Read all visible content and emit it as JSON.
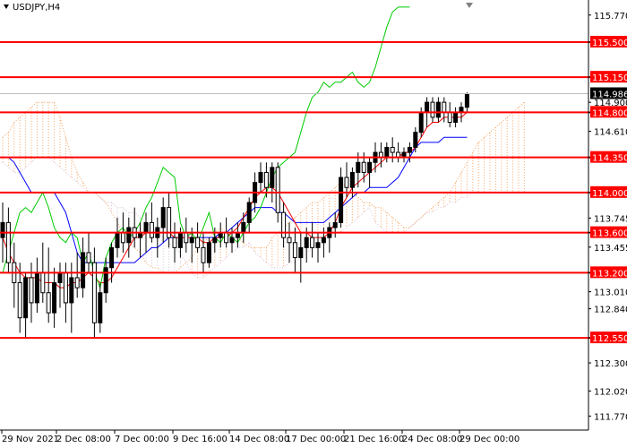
{
  "symbol_title": "USDJPY,H4",
  "colors": {
    "level_line": "#ff0000",
    "level_label_bg": "#ff0000",
    "level_label_text": "#ffffff",
    "current_label_bg": "#000000",
    "current_label_text": "#ffffff",
    "bull_candle": "#000000",
    "bear_candle": "#ffffff",
    "tenkan": "#ff0000",
    "kijun": "#0000ff",
    "chikou": "#00cc00",
    "cloud_bull": "#f4a460",
    "cloud_bear": "#d8bfd8",
    "grid": "#c0c0c0"
  },
  "chart_data": {
    "type": "candlestick",
    "title": "USDJPY,H4",
    "ylim": [
      111.63,
      115.92
    ],
    "y_ticks": [
      115.77,
      115.5,
      115.15,
      114.9,
      114.8,
      114.61,
      114.35,
      114.0,
      113.745,
      113.6,
      113.455,
      113.2,
      113.01,
      112.84,
      112.55,
      112.3,
      112.02,
      111.77
    ],
    "y_tick_labels": [
      "115.770",
      "115.500",
      "115.150",
      "114.900",
      "114.800",
      "114.610",
      "114.350",
      "114.000",
      "113.745",
      "113.600",
      "113.455",
      "113.200",
      "113.010",
      "112.840",
      "112.550",
      "112.300",
      "112.020",
      "111.770"
    ],
    "x_labels": [
      "29 Nov 2021",
      "2 Dec 08:00",
      "7 Dec 00:00",
      "9 Dec 16:00",
      "14 Dec 08:00",
      "17 Dec 00:00",
      "21 Dec 16:00",
      "24 Dec 08:00",
      "29 Dec 00:00"
    ],
    "levels": [
      115.5,
      115.15,
      114.8,
      114.35,
      114.0,
      113.6,
      113.2,
      112.55
    ],
    "level_labels": [
      "115.500",
      "115.150",
      "114.800",
      "114.350",
      "114.000",
      "113.600",
      "113.200",
      "112.550"
    ],
    "current_price": 114.986,
    "current_price_label": "114.986",
    "candles": [
      [
        113.55,
        113.9,
        113.3,
        113.7
      ],
      [
        113.7,
        113.85,
        113.2,
        113.3
      ],
      [
        113.3,
        113.5,
        112.85,
        113.1
      ],
      [
        113.1,
        113.3,
        112.6,
        112.75
      ],
      [
        112.75,
        113.2,
        112.55,
        113.15
      ],
      [
        113.15,
        113.3,
        112.7,
        112.9
      ],
      [
        112.9,
        113.35,
        112.8,
        113.2
      ],
      [
        113.2,
        113.5,
        112.9,
        113.0
      ],
      [
        113.0,
        113.45,
        112.7,
        112.8
      ],
      [
        112.8,
        113.25,
        112.65,
        113.1
      ],
      [
        113.1,
        113.3,
        112.85,
        113.2
      ],
      [
        113.2,
        113.3,
        112.7,
        112.9
      ],
      [
        112.9,
        113.3,
        112.6,
        113.15
      ],
      [
        113.15,
        113.4,
        112.95,
        113.05
      ],
      [
        113.05,
        113.55,
        112.95,
        113.4
      ],
      [
        113.4,
        113.6,
        113.2,
        113.3
      ],
      [
        113.3,
        113.45,
        112.55,
        112.7
      ],
      [
        112.7,
        113.1,
        112.6,
        113.0
      ],
      [
        113.0,
        113.35,
        112.9,
        113.25
      ],
      [
        113.25,
        113.5,
        113.1,
        113.45
      ],
      [
        113.45,
        113.75,
        113.35,
        113.6
      ],
      [
        113.6,
        113.8,
        113.4,
        113.5
      ],
      [
        113.5,
        113.75,
        113.35,
        113.65
      ],
      [
        113.65,
        113.85,
        113.45,
        113.55
      ],
      [
        113.55,
        113.7,
        113.35,
        113.6
      ],
      [
        113.6,
        113.8,
        113.4,
        113.7
      ],
      [
        113.7,
        113.9,
        113.5,
        113.55
      ],
      [
        113.55,
        113.75,
        113.35,
        113.65
      ],
      [
        113.65,
        113.95,
        113.5,
        113.85
      ],
      [
        113.85,
        114.0,
        113.45,
        113.55
      ],
      [
        113.55,
        113.7,
        113.3,
        113.45
      ],
      [
        113.45,
        113.65,
        113.35,
        113.6
      ],
      [
        113.6,
        113.75,
        113.4,
        113.5
      ],
      [
        113.5,
        113.65,
        113.3,
        113.55
      ],
      [
        113.55,
        113.7,
        113.4,
        113.45
      ],
      [
        113.45,
        113.6,
        113.2,
        113.3
      ],
      [
        113.3,
        113.55,
        113.25,
        113.5
      ],
      [
        113.5,
        113.65,
        113.4,
        113.55
      ],
      [
        113.55,
        113.7,
        113.45,
        113.6
      ],
      [
        113.6,
        113.75,
        113.45,
        113.5
      ],
      [
        113.5,
        113.65,
        113.4,
        113.55
      ],
      [
        113.55,
        113.7,
        113.45,
        113.6
      ],
      [
        113.6,
        113.8,
        113.5,
        113.7
      ],
      [
        113.7,
        113.95,
        113.6,
        113.9
      ],
      [
        113.9,
        114.2,
        113.8,
        114.1
      ],
      [
        114.1,
        114.3,
        114.0,
        114.2
      ],
      [
        114.2,
        114.3,
        113.95,
        114.05
      ],
      [
        114.05,
        114.3,
        113.9,
        114.25
      ],
      [
        114.25,
        114.3,
        113.7,
        113.8
      ],
      [
        113.8,
        113.9,
        113.45,
        113.55
      ],
      [
        113.55,
        113.7,
        113.3,
        113.5
      ],
      [
        113.5,
        113.65,
        113.2,
        113.35
      ],
      [
        113.35,
        113.6,
        113.1,
        113.45
      ],
      [
        113.45,
        113.65,
        113.3,
        113.55
      ],
      [
        113.55,
        113.7,
        113.35,
        113.45
      ],
      [
        113.45,
        113.6,
        113.3,
        113.5
      ],
      [
        113.5,
        113.65,
        113.35,
        113.55
      ],
      [
        113.55,
        113.7,
        113.4,
        113.65
      ],
      [
        113.65,
        113.8,
        113.55,
        113.7
      ],
      [
        113.7,
        114.25,
        113.65,
        114.15
      ],
      [
        114.15,
        114.3,
        113.95,
        114.05
      ],
      [
        114.05,
        114.25,
        113.95,
        114.2
      ],
      [
        114.2,
        114.4,
        114.05,
        114.3
      ],
      [
        114.3,
        114.4,
        114.1,
        114.2
      ],
      [
        114.2,
        114.35,
        114.05,
        114.3
      ],
      [
        114.3,
        114.5,
        114.2,
        114.4
      ],
      [
        114.4,
        114.5,
        114.25,
        114.35
      ],
      [
        114.35,
        114.5,
        114.3,
        114.45
      ],
      [
        114.45,
        114.55,
        114.3,
        114.4
      ],
      [
        114.4,
        114.5,
        114.3,
        114.35
      ],
      [
        114.35,
        114.45,
        114.3,
        114.4
      ],
      [
        114.4,
        114.5,
        114.3,
        114.45
      ],
      [
        114.45,
        114.65,
        114.4,
        114.6
      ],
      [
        114.6,
        114.85,
        114.55,
        114.8
      ],
      [
        114.8,
        114.95,
        114.65,
        114.9
      ],
      [
        114.9,
        114.95,
        114.7,
        114.75
      ],
      [
        114.75,
        114.95,
        114.7,
        114.9
      ],
      [
        114.9,
        114.95,
        114.7,
        114.8
      ],
      [
        114.8,
        114.9,
        114.65,
        114.7
      ],
      [
        114.7,
        114.85,
        114.65,
        114.8
      ],
      [
        114.8,
        114.9,
        114.7,
        114.85
      ],
      [
        114.85,
        115.0,
        114.8,
        114.986
      ]
    ],
    "series": [
      {
        "name": "",
        "type": "tenkan"
      },
      {
        "name": "",
        "type": "kijun"
      },
      {
        "name": "",
        "type": "chikou"
      }
    ],
    "tenkan": [
      113.55,
      113.4,
      113.3,
      113.2,
      113.15,
      113.15,
      113.15,
      113.1,
      113.1,
      113.1,
      113.05,
      113.05,
      113.1,
      113.1,
      113.15,
      113.2,
      113.15,
      113.1,
      113.1,
      113.15,
      113.25,
      113.35,
      113.45,
      113.55,
      113.55,
      113.6,
      113.6,
      113.6,
      113.6,
      113.6,
      113.55,
      113.55,
      113.55,
      113.55,
      113.55,
      113.5,
      113.5,
      113.55,
      113.55,
      113.55,
      113.6,
      113.65,
      113.75,
      113.85,
      113.95,
      114.0,
      114.05,
      114.05,
      114.0,
      113.9,
      113.8,
      113.7,
      113.6,
      113.6,
      113.55,
      113.55,
      113.55,
      113.6,
      113.7,
      113.85,
      113.95,
      114.05,
      114.1,
      114.15,
      114.2,
      114.25,
      114.3,
      114.35,
      114.35,
      114.35,
      114.4,
      114.4,
      114.45,
      114.55,
      114.65,
      114.7,
      114.7,
      114.75,
      114.75,
      114.75,
      114.75,
      114.8
    ],
    "kijun": [
      114.35,
      114.35,
      114.3,
      114.2,
      114.1,
      114.0,
      114.0,
      114.0,
      114.0,
      114.0,
      113.9,
      113.8,
      113.6,
      113.4,
      113.3,
      113.3,
      113.3,
      113.3,
      113.3,
      113.3,
      113.3,
      113.3,
      113.3,
      113.3,
      113.35,
      113.4,
      113.45,
      113.45,
      113.5,
      113.55,
      113.55,
      113.55,
      113.55,
      113.55,
      113.55,
      113.55,
      113.55,
      113.55,
      113.6,
      113.6,
      113.65,
      113.7,
      113.75,
      113.8,
      113.85,
      113.85,
      113.85,
      113.85,
      113.8,
      113.8,
      113.75,
      113.7,
      113.7,
      113.7,
      113.7,
      113.7,
      113.7,
      113.75,
      113.8,
      113.85,
      113.9,
      113.95,
      114.0,
      114.0,
      114.05,
      114.05,
      114.05,
      114.05,
      114.1,
      114.15,
      114.25,
      114.35,
      114.45,
      114.5,
      114.5,
      114.5,
      114.5,
      114.55,
      114.55,
      114.55,
      114.55,
      114.55
    ],
    "chikou": [
      113.2,
      113.4,
      113.6,
      113.8,
      113.85,
      113.8,
      113.9,
      114.0,
      113.85,
      113.65,
      113.55,
      113.5,
      113.6,
      113.55,
      113.3,
      113.4,
      113.2,
      113.05,
      113.35,
      113.5,
      113.6,
      113.65,
      113.55,
      113.6,
      113.7,
      113.85,
      113.95,
      114.1,
      114.25,
      114.2,
      114.15,
      113.7,
      113.55,
      113.6,
      113.5,
      113.65,
      113.8,
      113.55,
      113.5,
      113.6,
      113.55,
      113.5,
      113.6,
      113.7,
      113.75,
      113.85,
      114.0,
      114.15,
      114.25,
      114.3,
      114.35,
      114.4,
      114.6,
      114.8,
      114.95,
      115.0,
      115.1,
      115.05,
      115.1,
      115.1,
      115.15,
      115.2,
      115.1,
      115.05,
      115.1,
      115.25,
      115.45,
      115.65,
      115.8,
      115.85,
      115.85,
      115.85
    ],
    "cloud": {
      "senkou_a": [
        114.55,
        114.6,
        114.7,
        114.75,
        114.8,
        114.85,
        114.9,
        114.9,
        114.9,
        114.9,
        114.75,
        114.55,
        114.35,
        114.2,
        114.1,
        114.0,
        114.0,
        113.95,
        113.9,
        113.8,
        113.7,
        113.6,
        113.5,
        113.45,
        113.4,
        113.3,
        113.25,
        113.25,
        113.2,
        113.2,
        113.2,
        113.25,
        113.3,
        113.35,
        113.45,
        113.5,
        113.55,
        113.6,
        113.65,
        113.6,
        113.55,
        113.55,
        113.5,
        113.45,
        113.45,
        113.45,
        113.45,
        113.55,
        113.6,
        113.65,
        113.7,
        113.75,
        113.8,
        113.85,
        113.9,
        113.9,
        113.95,
        114.0,
        114.05,
        114.1,
        114.05,
        114.0,
        113.95,
        113.9,
        113.9,
        113.85,
        113.85,
        113.8,
        113.75,
        113.7,
        113.65,
        113.65,
        113.7,
        113.75,
        113.8,
        113.85,
        113.9,
        113.95,
        114.0,
        114.1,
        114.2,
        114.3,
        114.4,
        114.5,
        114.55,
        114.6,
        114.65,
        114.7,
        114.75,
        114.8,
        114.85,
        114.9
      ],
      "senkou_b": [
        114.3,
        114.25,
        114.2,
        114.2,
        114.25,
        114.3,
        114.35,
        114.35,
        114.35,
        114.3,
        114.25,
        114.2,
        114.15,
        114.1,
        114.05,
        114.0,
        114.0,
        113.95,
        113.9,
        113.9,
        113.85,
        113.85,
        113.8,
        113.8,
        113.75,
        113.7,
        113.65,
        113.6,
        113.55,
        113.5,
        113.45,
        113.4,
        113.3,
        113.2,
        113.15,
        113.15,
        113.2,
        113.25,
        113.3,
        113.35,
        113.4,
        113.45,
        113.45,
        113.5,
        113.4,
        113.35,
        113.3,
        113.25,
        113.25,
        113.25,
        113.3,
        113.3,
        113.35,
        113.4,
        113.45,
        113.5,
        113.55,
        113.55,
        113.6,
        113.6,
        113.65,
        113.7,
        113.75,
        113.8,
        113.85,
        113.7,
        113.65,
        113.6,
        113.6,
        113.6,
        113.6,
        113.65,
        113.7,
        113.75,
        113.8,
        113.8,
        113.85,
        113.85,
        113.9,
        113.9,
        113.95,
        113.95,
        114.0,
        114.0,
        114.0,
        114.0,
        114.0,
        114.0,
        114.0,
        114.0,
        114.0,
        114.0
      ]
    }
  }
}
